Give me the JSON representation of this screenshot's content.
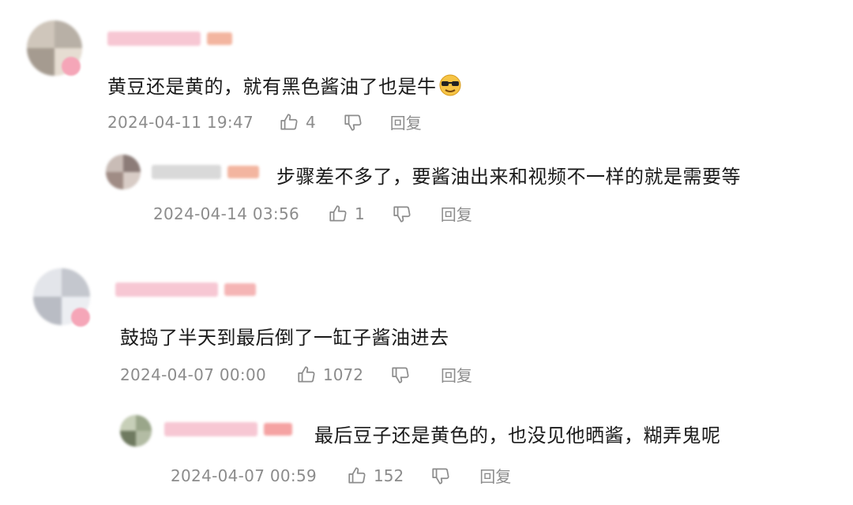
{
  "comments": [
    {
      "text": "黄豆还是黄的，就有黑色酱油了也是牛",
      "emoji": "cool-sunglasses-emoji",
      "time": "2024-04-11 19:47",
      "likes": "4",
      "reply_label": "回复",
      "reply": {
        "text": "步骤差不多了，要酱油出来和视频不一样的就是需要等",
        "time": "2024-04-14 03:56",
        "likes": "1",
        "reply_label": "回复"
      }
    },
    {
      "text": "鼓捣了半天到最后倒了一缸子酱油进去",
      "time": "2024-04-07 00:00",
      "likes": "1072",
      "reply_label": "回复",
      "reply": {
        "text": "最后豆子还是黄色的，也没见他晒酱，糊弄鬼呢",
        "time": "2024-04-07 00:59",
        "likes": "152",
        "reply_label": "回复"
      }
    }
  ],
  "colors": {
    "meta_gray": "#8c8c8c",
    "text": "#1a1a1a",
    "username_pink": "#f7c7d3"
  },
  "icons": [
    "thumbs-up-icon",
    "thumbs-down-icon"
  ]
}
